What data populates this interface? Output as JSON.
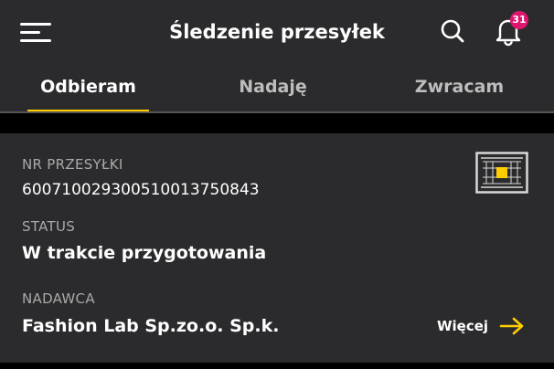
{
  "header": {
    "title": "Śledzenie przesyłek",
    "notifications_count": "31",
    "icons": {
      "menu": "menu-icon",
      "search": "search-icon",
      "notifications": "bell-icon"
    }
  },
  "tabs": [
    {
      "label": "Odbieram",
      "active": true
    },
    {
      "label": "Nadaję",
      "active": false
    },
    {
      "label": "Zwracam",
      "active": false
    }
  ],
  "shipment": {
    "number_label": "NR PRZESYŁKI",
    "number": "600710029300510013750843",
    "status_label": "STATUS",
    "status": "W trakcie przygotowania",
    "sender_label": "NADAWCA",
    "sender": "Fashion Lab Sp.zo.o. Sp.k.",
    "more_label": "Więcej",
    "qr_icon": "qr-code-icon",
    "more_icon": "arrow-right-icon"
  },
  "colors": {
    "accent": "#ffcd00",
    "badge": "#e0156e",
    "surface": "#2b2b2d",
    "background": "#000000"
  }
}
